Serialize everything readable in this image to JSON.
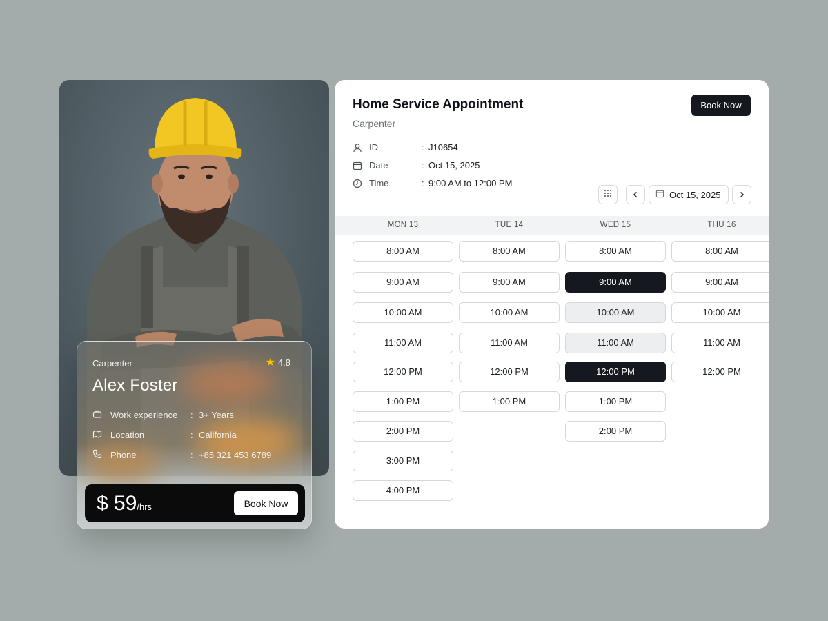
{
  "profile": {
    "role": "Carpenter",
    "rating": "4.8",
    "name": "Alex Foster",
    "details": [
      {
        "icon": "briefcase-icon",
        "label": "Work experience",
        "value": "3+ Years"
      },
      {
        "icon": "map-icon",
        "label": "Location",
        "value": "California"
      },
      {
        "icon": "phone-icon",
        "label": "Phone",
        "value": "+85 321 453 6789"
      }
    ],
    "price": "$ 59",
    "price_unit": "/hrs",
    "book_label": "Book Now"
  },
  "appointment": {
    "title": "Home Service Appointment",
    "subtitle": "Carpenter",
    "book_label": "Book Now",
    "meta": [
      {
        "icon": "user-icon",
        "label": "ID",
        "value": "J10654"
      },
      {
        "icon": "calendar-icon",
        "label": "Date",
        "value": "Oct 15, 2025"
      },
      {
        "icon": "clock-icon",
        "label": "Time",
        "value": "9:00 AM to 12:00 PM"
      }
    ],
    "date_picker": "Oct 15, 2025",
    "days": [
      {
        "label": "MON 13",
        "slots": [
          "8:00 AM",
          "9:00 AM",
          "10:00 AM",
          "11:00 AM",
          "12:00 PM",
          "1:00 PM",
          "2:00 PM",
          "3:00 PM",
          "4:00 PM"
        ]
      },
      {
        "label": "TUE 14",
        "slots": [
          "8:00 AM",
          "9:00 AM",
          "10:00 AM",
          "11:00 AM",
          "12:00 PM",
          "1:00 PM"
        ]
      },
      {
        "label": "WED 15",
        "slots": [
          "8:00 AM",
          "9:00 AM",
          "10:00 AM",
          "11:00 AM",
          "12:00 PM",
          "1:00 PM",
          "2:00 PM"
        ]
      },
      {
        "label": "THU 16",
        "slots": [
          "8:00 AM",
          "9:00 AM",
          "10:00 AM",
          "11:00 AM",
          "12:00 PM"
        ]
      }
    ],
    "selected_day": "WED 15",
    "selected_slots": [
      "9:00 AM",
      "12:00 PM"
    ],
    "range_slots": [
      "10:00 AM",
      "11:00 AM"
    ]
  },
  "colors": {
    "background": "#a3acaa",
    "selected": "#15181f",
    "range": "#eceef0",
    "helmet": "#f2c623",
    "star": "#f5c400"
  }
}
